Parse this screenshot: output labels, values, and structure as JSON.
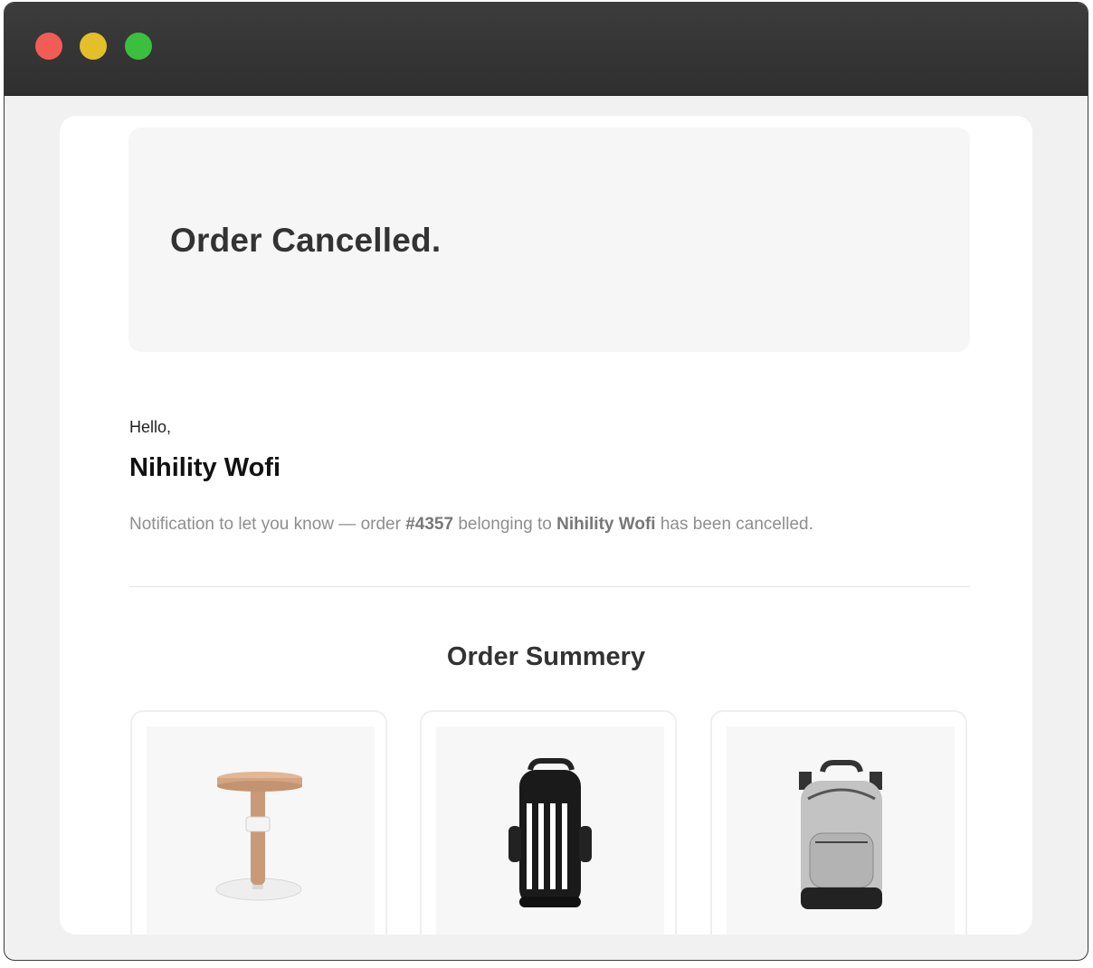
{
  "window": {
    "controls": [
      "close",
      "minimize",
      "zoom"
    ]
  },
  "email": {
    "hero_title": "Order Cancelled.",
    "greeting": "Hello,",
    "customer_name": "Nihility Wofi",
    "message": {
      "prefix": "Notification to let you know — order ",
      "order_number": "#4357",
      "middle": " belonging to ",
      "customer": "Nihility Wofi",
      "suffix": " has been cancelled."
    },
    "summary_title": "Order Summery",
    "products": [
      {
        "icon": "wooden-stool-image"
      },
      {
        "icon": "black-striped-backpack-image"
      },
      {
        "icon": "grey-backpack-image"
      }
    ]
  },
  "colors": {
    "titlebar": "#333333",
    "close": "#f25c56",
    "minimize": "#e3c02a",
    "zoom": "#3ac03e",
    "hero_bg": "#f6f6f6",
    "muted_text": "#8e8e8e"
  }
}
